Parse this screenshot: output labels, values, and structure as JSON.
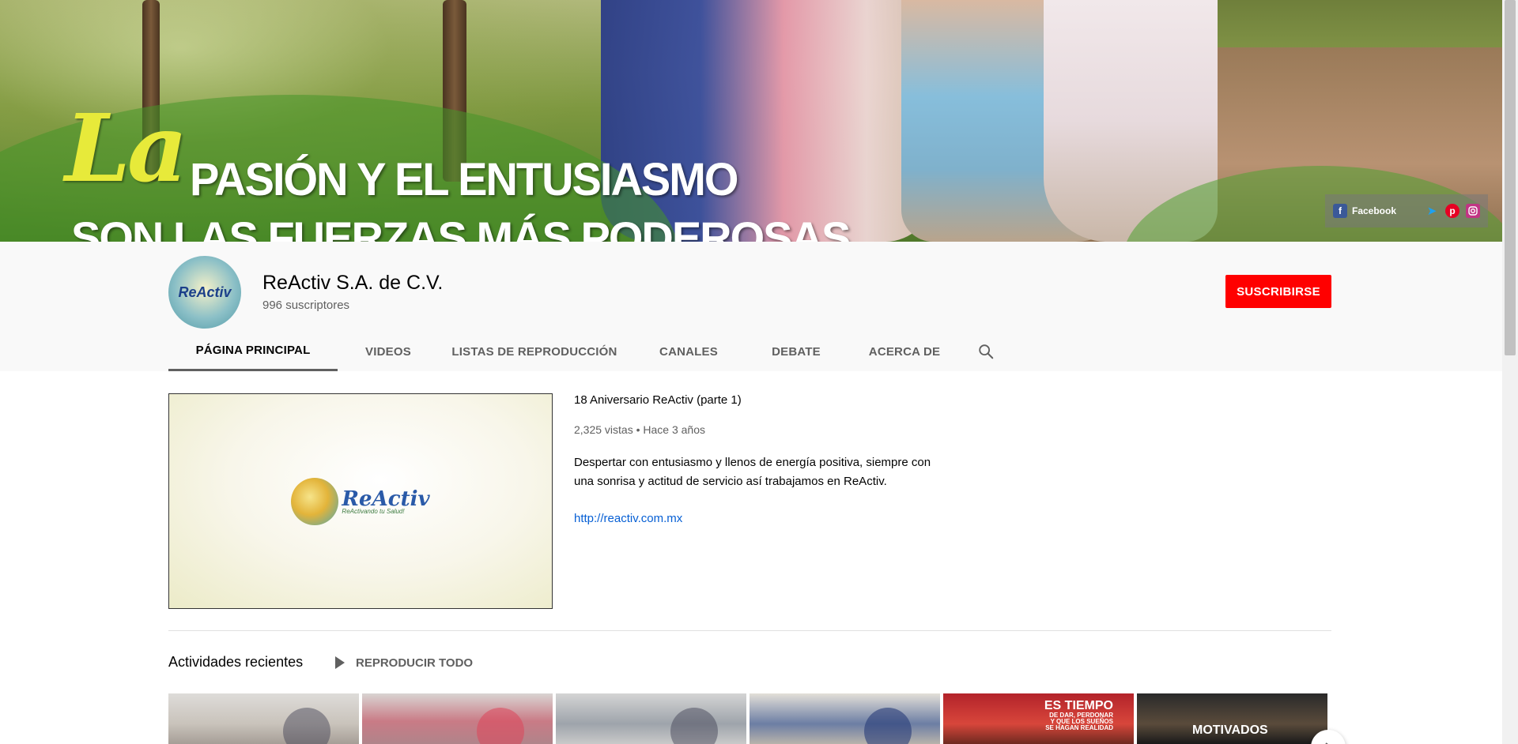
{
  "banner": {
    "script_word": "La",
    "line1": "PASIÓN Y EL ENTUSIASMO",
    "line2": "SON LAS FUERZAS MÁS PODEROSAS",
    "social": {
      "facebook_label": "Facebook",
      "icons": [
        "facebook-icon",
        "twitter-icon",
        "pinterest-icon",
        "instagram-icon"
      ]
    }
  },
  "channel": {
    "name": "ReActiv S.A. de C.V.",
    "subscribers": "996 suscriptores",
    "subscribe_label": "SUSCRIBIRSE",
    "avatar_text": "ReActiv"
  },
  "tabs": [
    {
      "label": "PÁGINA PRINCIPAL",
      "active": true
    },
    {
      "label": "VIDEOS",
      "active": false
    },
    {
      "label": "LISTAS DE REPRODUCCIÓN",
      "active": false
    },
    {
      "label": "CANALES",
      "active": false
    },
    {
      "label": "DEBATE",
      "active": false
    },
    {
      "label": "ACERCA DE",
      "active": false
    }
  ],
  "featured": {
    "title": "18 Aniversario ReActiv (parte 1)",
    "meta": "2,325 vistas • Hace 3 años",
    "description": "Despertar con entusiasmo y llenos de energía positiva, siempre con una sonrisa y actitud de servicio así trabajamos en ReActiv.",
    "link": "http://reactiv.com.mx",
    "logo_text": "ReActiv",
    "logo_tagline": "ReActivando tu Salud!"
  },
  "shelf": {
    "title": "Actividades recientes",
    "play_all_label": "REPRODUCIR TODO",
    "thumb5": {
      "big": "ES TIEMPO",
      "small": [
        "DE DAR, PERDONAR",
        "Y QUE LOS SUEÑOS",
        "SE HAGAN REALIDAD"
      ]
    },
    "thumb6": {
      "text": "MOTIVADOS"
    }
  },
  "colors": {
    "accent_red": "#ff0000",
    "link_blue": "#065fd4",
    "facebook_blue": "#3b5998",
    "twitter_blue": "#1da1f2",
    "pinterest_red": "#e60023",
    "instagram_pink": "#c13584"
  }
}
